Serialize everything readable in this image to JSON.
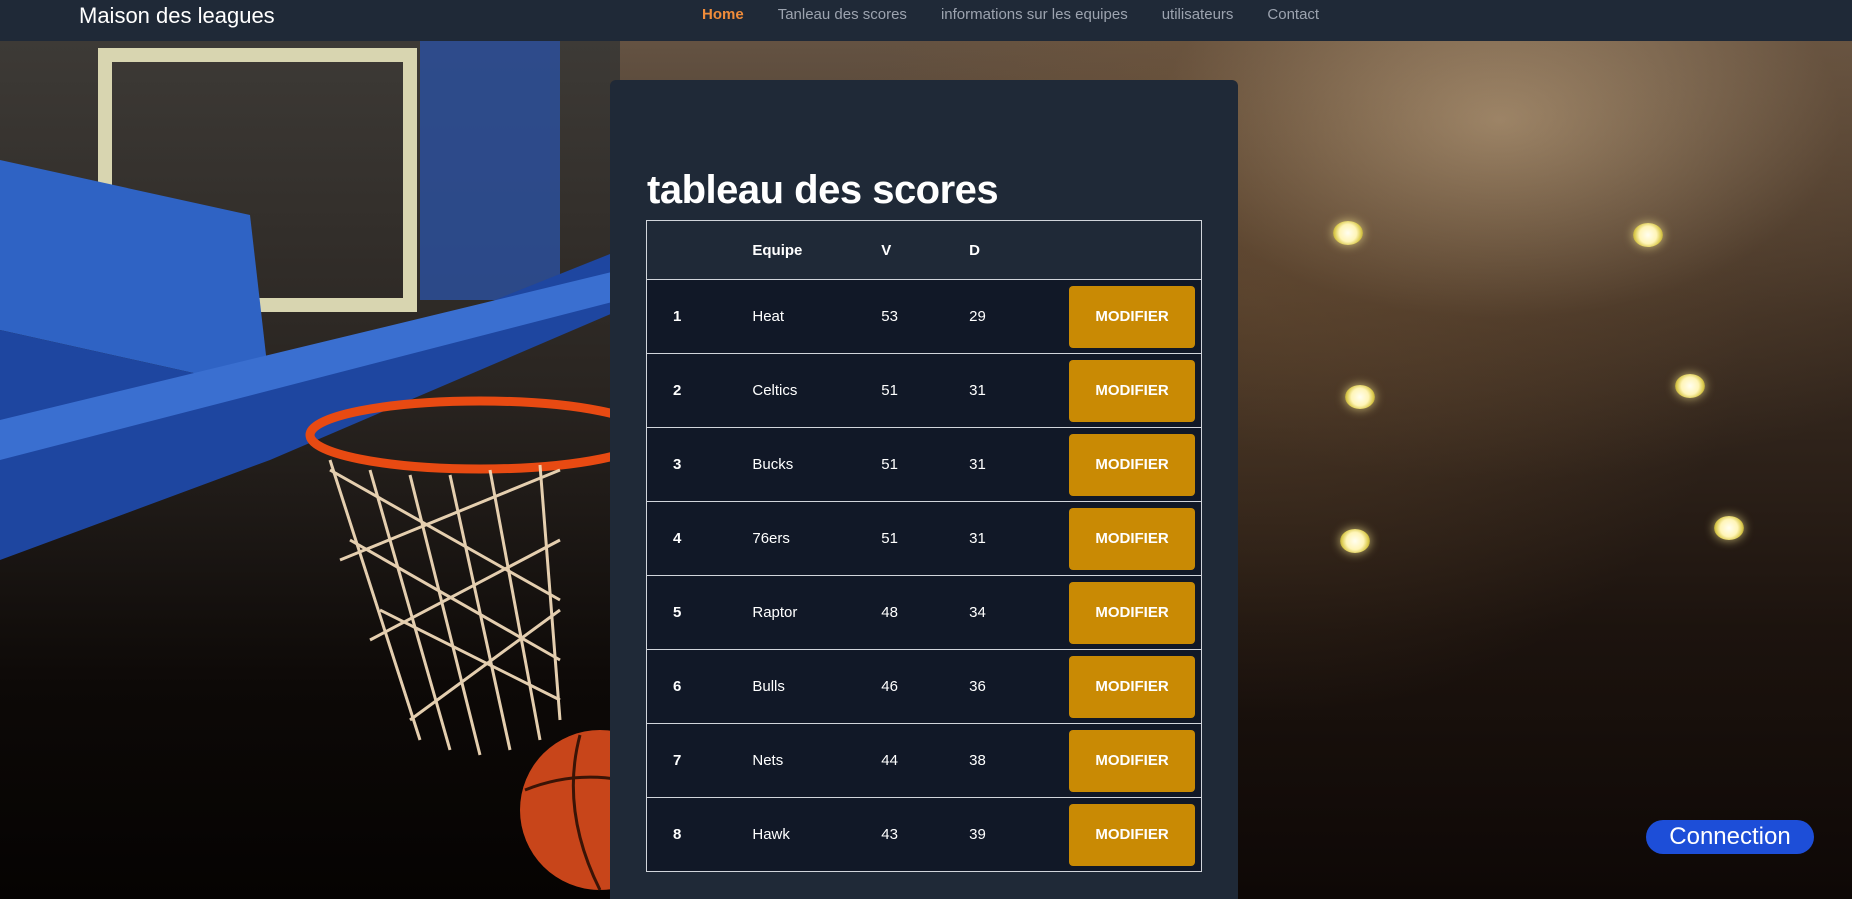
{
  "navbar": {
    "brand": "Maison des leagues",
    "links": [
      {
        "label": "Home",
        "active": true
      },
      {
        "label": "Tanleau des scores",
        "active": false
      },
      {
        "label": "informations sur les equipes",
        "active": false
      },
      {
        "label": "utilisateurs",
        "active": false
      },
      {
        "label": "Contact",
        "active": false
      }
    ]
  },
  "scoreboard": {
    "title": "tableau des scores",
    "headers": {
      "rank": "",
      "team": "Equipe",
      "wins": "V",
      "losses": "D"
    },
    "rows": [
      {
        "rank": "1",
        "team": "Heat",
        "wins": "53",
        "losses": "29",
        "action": "MODIFIER"
      },
      {
        "rank": "2",
        "team": "Celtics",
        "wins": "51",
        "losses": "31",
        "action": "MODIFIER"
      },
      {
        "rank": "3",
        "team": "Bucks",
        "wins": "51",
        "losses": "31",
        "action": "MODIFIER"
      },
      {
        "rank": "4",
        "team": "76ers",
        "wins": "51",
        "losses": "31",
        "action": "MODIFIER"
      },
      {
        "rank": "5",
        "team": "Raptor",
        "wins": "48",
        "losses": "34",
        "action": "MODIFIER"
      },
      {
        "rank": "6",
        "team": "Bulls",
        "wins": "46",
        "losses": "36",
        "action": "MODIFIER"
      },
      {
        "rank": "7",
        "team": "Nets",
        "wins": "44",
        "losses": "38",
        "action": "MODIFIER"
      },
      {
        "rank": "8",
        "team": "Hawk",
        "wins": "43",
        "losses": "39",
        "action": "MODIFIER"
      }
    ]
  },
  "connection_button": "Connection",
  "colors": {
    "navbar_bg": "#1f2937",
    "nav_active": "#f08c3a",
    "nav_inactive": "#9ca3af",
    "card_bg": "#1f2937",
    "row_bg": "#111827",
    "modifier_button": "#c98a04",
    "connection_button": "#1d4ed8"
  },
  "icons": [
    "basketball-hoop-background",
    "stadium-lights-background"
  ]
}
